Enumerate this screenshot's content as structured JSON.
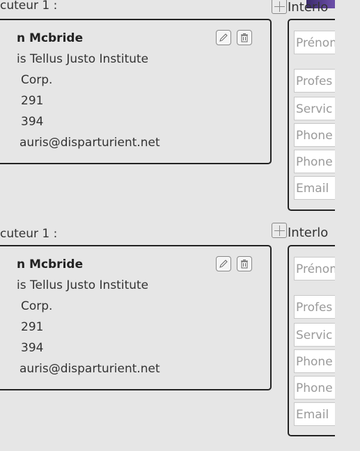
{
  "blocks": [
    {
      "title": "cuteur 1 :",
      "contact": {
        "name": "n Mcbride",
        "org": "is Tellus Justo Institute",
        "company": "Corp.",
        "phone1": "291",
        "phone2": "394",
        "email": "auris@disparturient.net"
      },
      "right_title": "Interlo",
      "fields": [
        "Prénom",
        "Profes",
        "Servic",
        "Phone",
        "Phone",
        "Email"
      ]
    },
    {
      "title": "cuteur 1 :",
      "contact": {
        "name": "n Mcbride",
        "org": "is Tellus Justo Institute",
        "company": "Corp.",
        "phone1": "291",
        "phone2": "394",
        "email": "auris@disparturient.net"
      },
      "right_title": "Interlo",
      "fields": [
        "Prénom",
        "Profes",
        "Servic",
        "Phone",
        "Phone",
        "Email"
      ]
    }
  ],
  "icons": {
    "edit": "pencil-icon",
    "delete": "trash-icon",
    "add": "plus-icon"
  }
}
